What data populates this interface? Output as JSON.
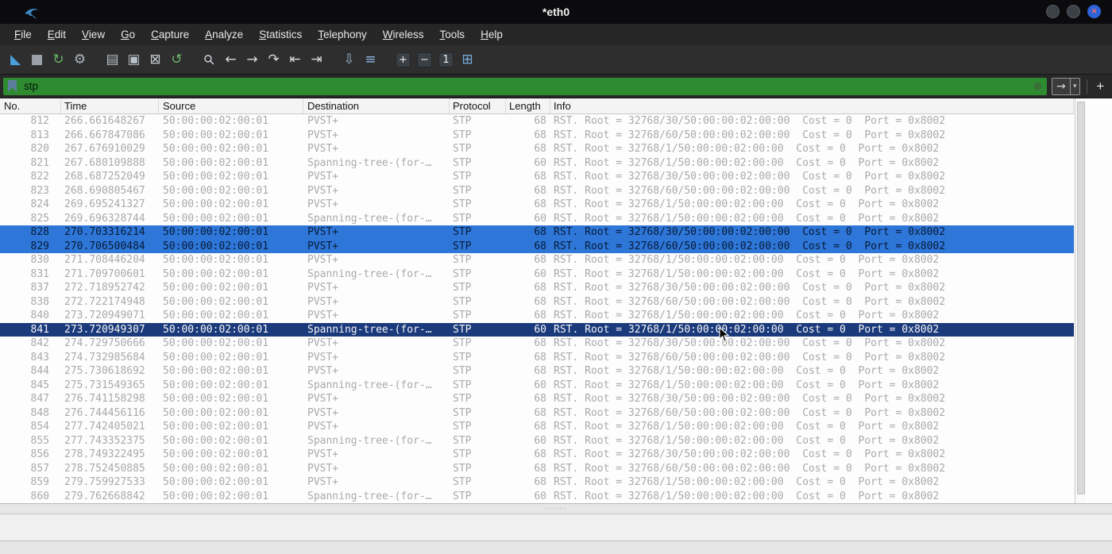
{
  "window": {
    "title": "*eth0"
  },
  "colors": {
    "filter_valid_bg": "#2e8b30",
    "row_selected_bg": "#2e76d8",
    "row_selected_text": "#071c38",
    "row_focus_bg": "#1a3a7c",
    "row_focus_text": "#f5f5f5",
    "dim_row_text": "#aaaaaa"
  },
  "menubar": {
    "items": [
      "File",
      "Edit",
      "View",
      "Go",
      "Capture",
      "Analyze",
      "Statistics",
      "Telephony",
      "Wireless",
      "Tools",
      "Help"
    ]
  },
  "toolbar": {
    "items": [
      "start-capture-icon",
      "stop-capture-icon",
      "restart-capture-icon",
      "capture-options-icon",
      "sep",
      "open-file-icon",
      "save-file-icon",
      "close-file-icon",
      "reload-icon",
      "sep",
      "find-packet-icon",
      "go-back-icon",
      "go-forward-icon",
      "goto-packet-icon",
      "go-first-icon",
      "go-last-icon",
      "sep",
      "autoscroll-icon",
      "colorize-icon",
      "sep",
      "zoom-in-icon",
      "zoom-out-icon",
      "zoom-100-icon",
      "resize-columns-icon"
    ]
  },
  "icons": {
    "start-capture-icon": {
      "glyph": "◣",
      "color": "#4aa0dc"
    },
    "stop-capture-icon": {
      "glyph": "■",
      "color": "#9aa1a8"
    },
    "restart-capture-icon": {
      "glyph": "↻",
      "color": "#67b36a"
    },
    "capture-options-icon": {
      "glyph": "⚙",
      "color": "#aeb6bd"
    },
    "open-file-icon": {
      "glyph": "▤",
      "color": "#b9c0c7"
    },
    "save-file-icon": {
      "glyph": "▣",
      "color": "#b9c0c7"
    },
    "close-file-icon": {
      "glyph": "⊠",
      "color": "#c4cacf"
    },
    "reload-icon": {
      "glyph": "↺",
      "color": "#6cb56f"
    },
    "find-packet-icon": {
      "glyph": "⚲",
      "color": "#c9ced3",
      "rot": -45
    },
    "go-back-icon": {
      "glyph": "←",
      "color": "#d6dadd"
    },
    "go-forward-icon": {
      "glyph": "→",
      "color": "#d6dadd"
    },
    "goto-packet-icon": {
      "glyph": "↷",
      "color": "#d6dadd"
    },
    "go-first-icon": {
      "glyph": "⇤",
      "color": "#d6dadd"
    },
    "go-last-icon": {
      "glyph": "⇥",
      "color": "#d6dadd"
    },
    "autoscroll-icon": {
      "glyph": "⇩",
      "color": "#9fb8d2"
    },
    "colorize-icon": {
      "glyph": "≡",
      "color": "#8cb8e6"
    },
    "zoom-in-icon": {
      "glyph": "+",
      "badge": true
    },
    "zoom-out-icon": {
      "glyph": "−",
      "badge": true
    },
    "zoom-100-icon": {
      "glyph": "1",
      "badge": true
    },
    "resize-columns-icon": {
      "glyph": "⊞",
      "color": "#79aede"
    },
    "clear-filter-icon": {
      "glyph": "⊗",
      "color": "#44563f"
    },
    "apply-filter-icon": {
      "glyph": "→",
      "color": "#d9d9d9"
    },
    "filter-dropdown-icon": {
      "glyph": "▾",
      "color": "#c0c0c0"
    },
    "add-filter-icon": {
      "glyph": "+",
      "color": "#e8e8e8"
    },
    "close-window-icon": {
      "glyph": "✕",
      "color": "#ff6b5e"
    }
  },
  "filter": {
    "value": "stp"
  },
  "splitter": {
    "grip": "······"
  },
  "packets": {
    "columns": [
      {
        "key": "no",
        "label": "No."
      },
      {
        "key": "time",
        "label": "Time"
      },
      {
        "key": "src",
        "label": "Source"
      },
      {
        "key": "dst",
        "label": "Destination"
      },
      {
        "key": "proto",
        "label": "Protocol"
      },
      {
        "key": "len",
        "label": "Length"
      },
      {
        "key": "info",
        "label": "Info"
      }
    ],
    "rows": [
      {
        "no": "812",
        "time": "266.661648267",
        "src": "50:00:00:02:00:01",
        "dst": "PVST+",
        "proto": "STP",
        "len": "68",
        "info": "RST. Root = 32768/30/50:00:00:02:00:00  Cost = 0  Port = 0x8002",
        "state": "dim"
      },
      {
        "no": "813",
        "time": "266.667847086",
        "src": "50:00:00:02:00:01",
        "dst": "PVST+",
        "proto": "STP",
        "len": "68",
        "info": "RST. Root = 32768/60/50:00:00:02:00:00  Cost = 0  Port = 0x8002",
        "state": "dim"
      },
      {
        "no": "820",
        "time": "267.676910029",
        "src": "50:00:00:02:00:01",
        "dst": "PVST+",
        "proto": "STP",
        "len": "68",
        "info": "RST. Root = 32768/1/50:00:00:02:00:00  Cost = 0  Port = 0x8002",
        "state": "dim"
      },
      {
        "no": "821",
        "time": "267.680109888",
        "src": "50:00:00:02:00:01",
        "dst": "Spanning-tree-(for-…",
        "proto": "STP",
        "len": "60",
        "info": "RST. Root = 32768/1/50:00:00:02:00:00  Cost = 0  Port = 0x8002",
        "state": "dim"
      },
      {
        "no": "822",
        "time": "268.687252049",
        "src": "50:00:00:02:00:01",
        "dst": "PVST+",
        "proto": "STP",
        "len": "68",
        "info": "RST. Root = 32768/30/50:00:00:02:00:00  Cost = 0  Port = 0x8002",
        "state": "dim"
      },
      {
        "no": "823",
        "time": "268.690805467",
        "src": "50:00:00:02:00:01",
        "dst": "PVST+",
        "proto": "STP",
        "len": "68",
        "info": "RST. Root = 32768/60/50:00:00:02:00:00  Cost = 0  Port = 0x8002",
        "state": "dim"
      },
      {
        "no": "824",
        "time": "269.695241327",
        "src": "50:00:00:02:00:01",
        "dst": "PVST+",
        "proto": "STP",
        "len": "68",
        "info": "RST. Root = 32768/1/50:00:00:02:00:00  Cost = 0  Port = 0x8002",
        "state": "dim"
      },
      {
        "no": "825",
        "time": "269.696328744",
        "src": "50:00:00:02:00:01",
        "dst": "Spanning-tree-(for-…",
        "proto": "STP",
        "len": "60",
        "info": "RST. Root = 32768/1/50:00:00:02:00:00  Cost = 0  Port = 0x8002",
        "state": "dim"
      },
      {
        "no": "828",
        "time": "270.703316214",
        "src": "50:00:00:02:00:01",
        "dst": "PVST+",
        "proto": "STP",
        "len": "68",
        "info": "RST. Root = 32768/30/50:00:00:02:00:00  Cost = 0  Port = 0x8002",
        "state": "sel"
      },
      {
        "no": "829",
        "time": "270.706500484",
        "src": "50:00:00:02:00:01",
        "dst": "PVST+",
        "proto": "STP",
        "len": "68",
        "info": "RST. Root = 32768/60/50:00:00:02:00:00  Cost = 0  Port = 0x8002",
        "state": "sel"
      },
      {
        "no": "830",
        "time": "271.708446204",
        "src": "50:00:00:02:00:01",
        "dst": "PVST+",
        "proto": "STP",
        "len": "68",
        "info": "RST. Root = 32768/1/50:00:00:02:00:00  Cost = 0  Port = 0x8002",
        "state": "dim"
      },
      {
        "no": "831",
        "time": "271.709700601",
        "src": "50:00:00:02:00:01",
        "dst": "Spanning-tree-(for-…",
        "proto": "STP",
        "len": "60",
        "info": "RST. Root = 32768/1/50:00:00:02:00:00  Cost = 0  Port = 0x8002",
        "state": "dim"
      },
      {
        "no": "837",
        "time": "272.718952742",
        "src": "50:00:00:02:00:01",
        "dst": "PVST+",
        "proto": "STP",
        "len": "68",
        "info": "RST. Root = 32768/30/50:00:00:02:00:00  Cost = 0  Port = 0x8002",
        "state": "dim"
      },
      {
        "no": "838",
        "time": "272.722174948",
        "src": "50:00:00:02:00:01",
        "dst": "PVST+",
        "proto": "STP",
        "len": "68",
        "info": "RST. Root = 32768/60/50:00:00:02:00:00  Cost = 0  Port = 0x8002",
        "state": "dim"
      },
      {
        "no": "840",
        "time": "273.720949071",
        "src": "50:00:00:02:00:01",
        "dst": "PVST+",
        "proto": "STP",
        "len": "68",
        "info": "RST. Root = 32768/1/50:00:00:02:00:00  Cost = 0  Port = 0x8002",
        "state": "dim"
      },
      {
        "no": "841",
        "time": "273.720949307",
        "src": "50:00:00:02:00:01",
        "dst": "Spanning-tree-(for-…",
        "proto": "STP",
        "len": "60",
        "info": "RST. Root = 32768/1/50:00:00:02:00:00  Cost = 0  Port = 0x8002",
        "state": "focus"
      },
      {
        "no": "842",
        "time": "274.729750666",
        "src": "50:00:00:02:00:01",
        "dst": "PVST+",
        "proto": "STP",
        "len": "68",
        "info": "RST. Root = 32768/30/50:00:00:02:00:00  Cost = 0  Port = 0x8002",
        "state": "dim"
      },
      {
        "no": "843",
        "time": "274.732985684",
        "src": "50:00:00:02:00:01",
        "dst": "PVST+",
        "proto": "STP",
        "len": "68",
        "info": "RST. Root = 32768/60/50:00:00:02:00:00  Cost = 0  Port = 0x8002",
        "state": "dim"
      },
      {
        "no": "844",
        "time": "275.730618692",
        "src": "50:00:00:02:00:01",
        "dst": "PVST+",
        "proto": "STP",
        "len": "68",
        "info": "RST. Root = 32768/1/50:00:00:02:00:00  Cost = 0  Port = 0x8002",
        "state": "dim"
      },
      {
        "no": "845",
        "time": "275.731549365",
        "src": "50:00:00:02:00:01",
        "dst": "Spanning-tree-(for-…",
        "proto": "STP",
        "len": "60",
        "info": "RST. Root = 32768/1/50:00:00:02:00:00  Cost = 0  Port = 0x8002",
        "state": "dim"
      },
      {
        "no": "847",
        "time": "276.741158298",
        "src": "50:00:00:02:00:01",
        "dst": "PVST+",
        "proto": "STP",
        "len": "68",
        "info": "RST. Root = 32768/30/50:00:00:02:00:00  Cost = 0  Port = 0x8002",
        "state": "dim"
      },
      {
        "no": "848",
        "time": "276.744456116",
        "src": "50:00:00:02:00:01",
        "dst": "PVST+",
        "proto": "STP",
        "len": "68",
        "info": "RST. Root = 32768/60/50:00:00:02:00:00  Cost = 0  Port = 0x8002",
        "state": "dim"
      },
      {
        "no": "854",
        "time": "277.742405021",
        "src": "50:00:00:02:00:01",
        "dst": "PVST+",
        "proto": "STP",
        "len": "68",
        "info": "RST. Root = 32768/1/50:00:00:02:00:00  Cost = 0  Port = 0x8002",
        "state": "dim"
      },
      {
        "no": "855",
        "time": "277.743352375",
        "src": "50:00:00:02:00:01",
        "dst": "Spanning-tree-(for-…",
        "proto": "STP",
        "len": "60",
        "info": "RST. Root = 32768/1/50:00:00:02:00:00  Cost = 0  Port = 0x8002",
        "state": "dim"
      },
      {
        "no": "856",
        "time": "278.749322495",
        "src": "50:00:00:02:00:01",
        "dst": "PVST+",
        "proto": "STP",
        "len": "68",
        "info": "RST. Root = 32768/30/50:00:00:02:00:00  Cost = 0  Port = 0x8002",
        "state": "dim"
      },
      {
        "no": "857",
        "time": "278.752450885",
        "src": "50:00:00:02:00:01",
        "dst": "PVST+",
        "proto": "STP",
        "len": "68",
        "info": "RST. Root = 32768/60/50:00:00:02:00:00  Cost = 0  Port = 0x8002",
        "state": "dim"
      },
      {
        "no": "859",
        "time": "279.759927533",
        "src": "50:00:00:02:00:01",
        "dst": "PVST+",
        "proto": "STP",
        "len": "68",
        "info": "RST. Root = 32768/1/50:00:00:02:00:00  Cost = 0  Port = 0x8002",
        "state": "dim"
      },
      {
        "no": "860",
        "time": "279.762668842",
        "src": "50:00:00:02:00:01",
        "dst": "Spanning-tree-(for-…",
        "proto": "STP",
        "len": "60",
        "info": "RST. Root = 32768/1/50:00:00:02:00:00  Cost = 0  Port = 0x8002",
        "state": "dim"
      }
    ]
  }
}
